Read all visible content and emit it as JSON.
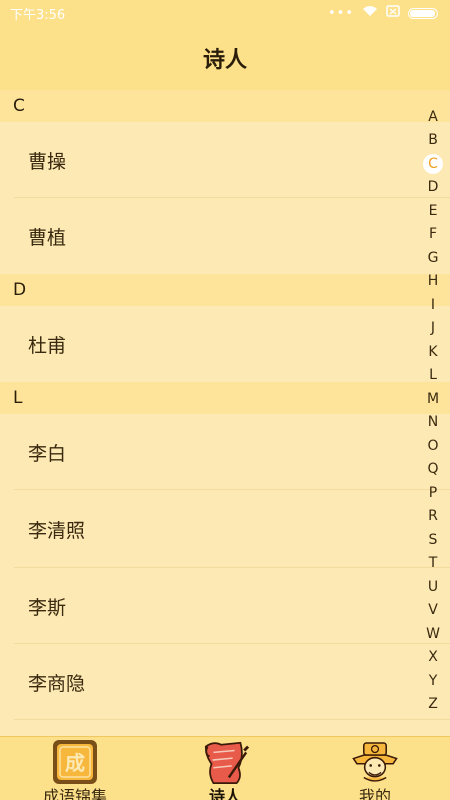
{
  "status_bar": {
    "time": "下午3:56",
    "dots": "•••"
  },
  "header": {
    "title": "诗人"
  },
  "sections": [
    {
      "letter": "C",
      "poets": [
        "曹操",
        "曹植"
      ]
    },
    {
      "letter": "D",
      "poets": [
        "杜甫"
      ]
    },
    {
      "letter": "L",
      "poets": [
        "李白",
        "李清照",
        "李斯",
        "李商隐"
      ]
    }
  ],
  "index_letters": [
    "A",
    "B",
    "C",
    "D",
    "E",
    "F",
    "G",
    "H",
    "I",
    "J",
    "K",
    "L",
    "M",
    "N",
    "O",
    "Q",
    "P",
    "R",
    "S",
    "T",
    "U",
    "V",
    "W",
    "X",
    "Y",
    "Z"
  ],
  "index_active": "C",
  "tabs": [
    {
      "label": "成语锦集",
      "icon": "idiom-seal-icon",
      "active": false
    },
    {
      "label": "诗人",
      "icon": "scroll-icon",
      "active": true
    },
    {
      "label": "我的",
      "icon": "scholar-icon",
      "active": false
    }
  ],
  "colors": {
    "header_bg": "#fde08a",
    "list_bg": "#fde9b3",
    "active_index": "#f0a020"
  }
}
